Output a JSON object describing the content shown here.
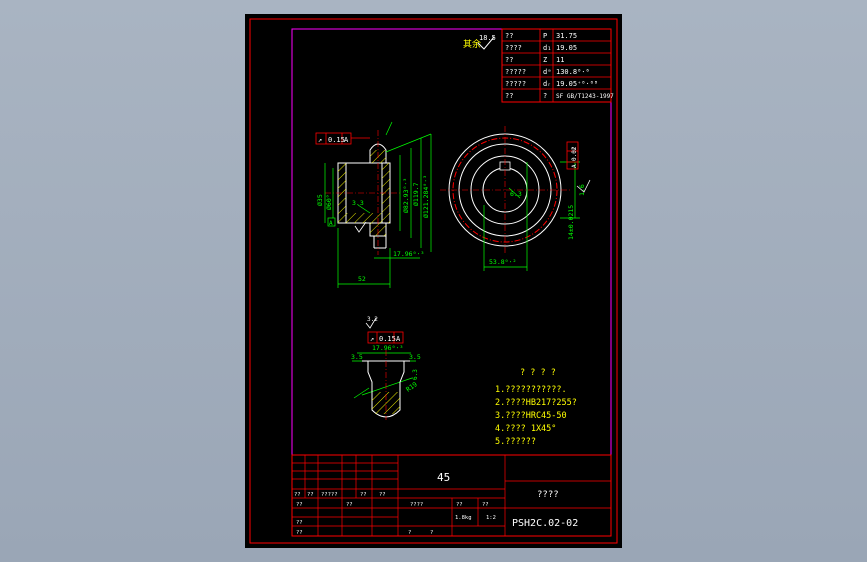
{
  "params_table": {
    "rows": [
      {
        "name": "??",
        "sym": "P",
        "val": "31.75"
      },
      {
        "name": "????",
        "sym": "d₁",
        "val": "19.05"
      },
      {
        "name": "??",
        "sym": "Z",
        "val": "11"
      },
      {
        "name": "?????",
        "sym": "dᵃ",
        "val": "130.8⁰⋅⁶"
      },
      {
        "name": "?????",
        "sym": "dᵣ",
        "val": "19.05⁺⁰·⁰⁸"
      },
      {
        "name": "??",
        "sym": "?",
        "val": "SF GB/T1243-1997"
      }
    ]
  },
  "roughness_note": {
    "prefix": "其余",
    "value": "18.5"
  },
  "drawing_labels": {
    "tol_front": [
      "↗",
      "0.15",
      "A"
    ],
    "tol_side": [
      "↗",
      "0.15",
      "A"
    ],
    "tol_right": [
      "⫽",
      "0.02",
      "A"
    ],
    "datum": "A",
    "dim_d35": "Ø35",
    "dim_d60": "Ø60°",
    "dim_d82": "Ø82.93⁰⋅³",
    "dim_d119": "Ø119.7",
    "dim_d121": "Ø121.284⁰⋅³",
    "dim_1796": "17.96⁰⋅³",
    "dim_52": "52",
    "dim_33": "3.3",
    "dim_1796_b": "17.96⁰⋅³",
    "dim_35a": "3.5",
    "dim_35b": "3.5",
    "dim_r19": "R19",
    "dim_533": "53.8⁰⋅²",
    "dim_keyway": "14±0.0215",
    "dim_63": "6.3",
    "dim_16": "1.6",
    "dim_32": "3.2"
  },
  "tech_req": {
    "title": "? ? ? ?",
    "lines": [
      "1.???????????.",
      "2.????HB217?255?",
      "3.????HRC45-50",
      "4.????  1X45°",
      "5.??????"
    ]
  },
  "title_block": {
    "material": "45",
    "part_name": "????",
    "drawing_no": "PSH2C.02-02",
    "row1": [
      "??",
      "??",
      "?????",
      "??",
      "??"
    ],
    "row2": [
      "??",
      "?",
      "??"
    ],
    "row3": [
      "??",
      "?",
      "??"
    ],
    "stage": "????",
    "weight_hdr": "??",
    "scale_hdr": "??",
    "weight": "1.8kg",
    "scale": "1:2",
    "sheet_a": "?",
    "sheet_b": "?"
  }
}
